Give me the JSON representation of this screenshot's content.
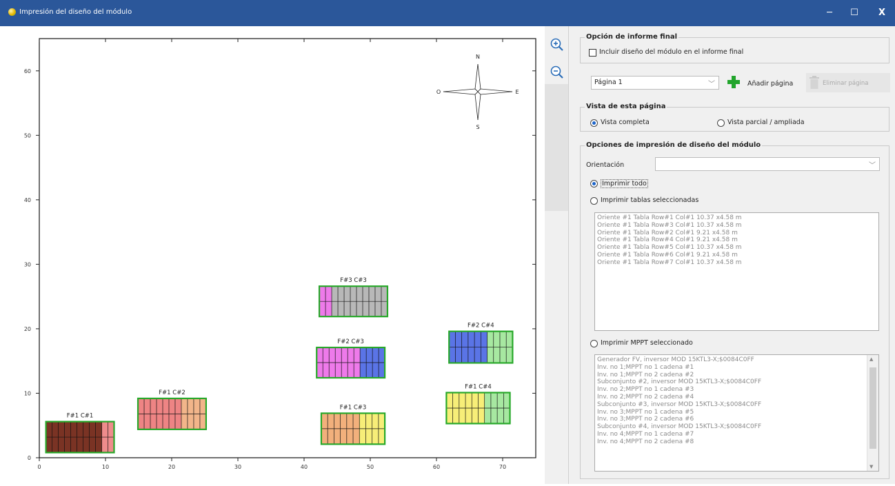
{
  "window": {
    "title": "Impresión del diseño del módulo",
    "minimize": "─",
    "maximize": "☐",
    "close": "X"
  },
  "compass": {
    "n": "N",
    "s": "S",
    "e": "E",
    "w": "O"
  },
  "chart_data": {
    "type": "layout",
    "xlim": [
      0,
      75
    ],
    "ylim": [
      0,
      65
    ],
    "x_ticks": [
      0,
      10,
      20,
      30,
      40,
      50,
      60,
      70
    ],
    "y_ticks": [
      0,
      10,
      20,
      30,
      40,
      50,
      60
    ],
    "tables": [
      {
        "label": "F#1 C#1",
        "x0": 1,
        "x1": 11.3,
        "y0": 0.8,
        "y1": 5.6,
        "rows": 2,
        "cols": 11,
        "segments": [
          {
            "cols": 9,
            "color": "#7a3324"
          },
          {
            "cols": 2,
            "color": "#ef8c8c"
          }
        ]
      },
      {
        "label": "F#1 C#2",
        "x0": 14.9,
        "x1": 25.2,
        "y0": 4.4,
        "y1": 9.2,
        "rows": 2,
        "cols": 11,
        "segments": [
          {
            "cols": 7,
            "color": "#ee8484"
          },
          {
            "cols": 4,
            "color": "#f2b58a"
          }
        ]
      },
      {
        "label": "F#1 C#3",
        "x0": 42.6,
        "x1": 52.2,
        "y0": 2.1,
        "y1": 6.9,
        "rows": 2,
        "cols": 10,
        "segments": [
          {
            "cols": 6,
            "color": "#f2b07c"
          },
          {
            "cols": 4,
            "color": "#f7ee78"
          }
        ]
      },
      {
        "label": "F#2 C#3",
        "x0": 41.9,
        "x1": 52.2,
        "y0": 12.4,
        "y1": 17.1,
        "rows": 2,
        "cols": 11,
        "segments": [
          {
            "cols": 7,
            "color": "#ee7aea"
          },
          {
            "cols": 4,
            "color": "#5a74e6"
          }
        ]
      },
      {
        "label": "F#3 C#3",
        "x0": 42.3,
        "x1": 52.6,
        "y0": 21.9,
        "y1": 26.6,
        "rows": 2,
        "cols": 11,
        "segments": [
          {
            "cols": 2,
            "color": "#ee7aea"
          },
          {
            "cols": 9,
            "color": "#b8b8b8"
          }
        ]
      },
      {
        "label": "F#1 C#4",
        "x0": 61.5,
        "x1": 71.1,
        "y0": 5.3,
        "y1": 10.1,
        "rows": 2,
        "cols": 10,
        "segments": [
          {
            "cols": 6,
            "color": "#f7ee78"
          },
          {
            "cols": 4,
            "color": "#a7e8a1"
          }
        ]
      },
      {
        "label": "F#2 C#4",
        "x0": 61.9,
        "x1": 71.5,
        "y0": 14.7,
        "y1": 19.6,
        "rows": 2,
        "cols": 10,
        "segments": [
          {
            "cols": 6,
            "color": "#5a74e6"
          },
          {
            "cols": 4,
            "color": "#a7e8a1"
          }
        ]
      }
    ]
  },
  "final_report": {
    "title": "Opción de informe final",
    "include_label": "Incluir diseño del módulo en el informe final"
  },
  "page_select": {
    "value": "Página 1",
    "add_label": "Añadir página",
    "delete_label": "Eliminar página"
  },
  "page_view": {
    "title": "Vista de esta página",
    "full_label": "Vista completa",
    "partial_label": "Vista parcial / ampliada"
  },
  "print_options": {
    "title": "Opciones de impresión de diseño del módulo",
    "orientation_label": "Orientación",
    "orientation_value": "",
    "print_all_label": "Imprimir todo",
    "print_tables_label": "Imprimir tablas seleccionadas",
    "tables": [
      "Oriente #1 Tabla Row#1 Col#1 10.37 x4.58 m",
      "Oriente #1 Tabla Row#3 Col#1 10.37 x4.58 m",
      "Oriente #1 Tabla Row#2 Col#1 9.21 x4.58 m",
      "Oriente #1 Tabla Row#4 Col#1 9.21 x4.58 m",
      "Oriente #1 Tabla Row#5 Col#1 10.37 x4.58 m",
      "Oriente #1 Tabla Row#6 Col#1 9.21 x4.58 m",
      "Oriente #1 Tabla Row#7 Col#1 10.37 x4.58 m"
    ],
    "print_mppt_label": "Imprimir MPPT seleccionado",
    "mppt_items": [
      "Generador FV,  inversor  MOD 15KTL3-X;$0084C0FF",
      "Inv. no 1;MPPT no 1 cadena #1",
      "Inv. no 1;MPPT no 2 cadena #2",
      "Subconjunto #2,  inversor  MOD 15KTL3-X;$0084C0FF",
      "Inv. no 2;MPPT no 1 cadena #3",
      "Inv. no 2;MPPT no 2 cadena #4",
      "Subconjunto #3,  inversor  MOD 15KTL3-X;$0084C0FF",
      "Inv. no 3;MPPT no 1 cadena #5",
      "Inv. no 3;MPPT no 2 cadena #6",
      "Subconjunto #4,  inversor  MOD 15KTL3-X;$0084C0FF",
      "Inv. no 4;MPPT no 1 cadena #7",
      "Inv. no 4;MPPT no 2 cadena #8"
    ]
  }
}
